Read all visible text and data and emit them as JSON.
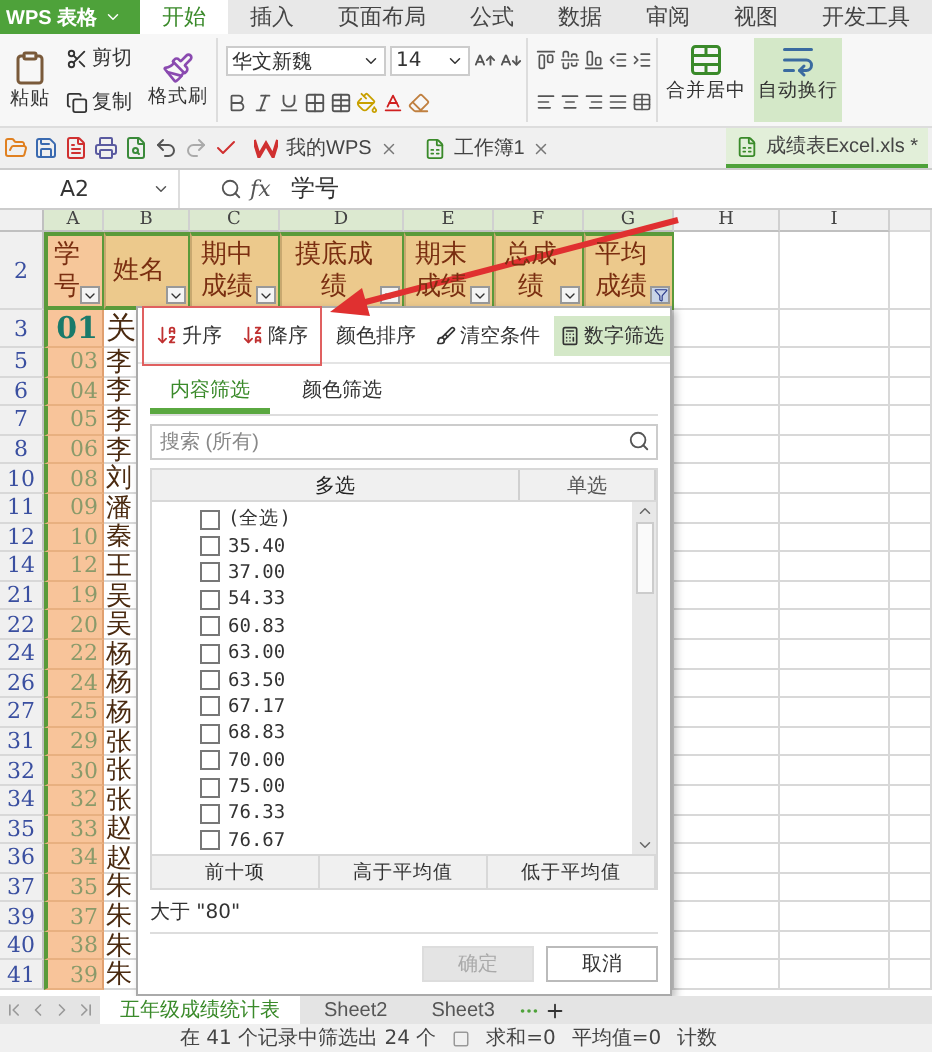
{
  "app_button": {
    "label": "WPS 表格"
  },
  "menu_tabs": [
    {
      "label": "开始",
      "selected": true
    },
    {
      "label": "插入",
      "selected": false
    },
    {
      "label": "页面布局",
      "selected": false
    },
    {
      "label": "公式",
      "selected": false
    },
    {
      "label": "数据",
      "selected": false
    },
    {
      "label": "审阅",
      "selected": false
    },
    {
      "label": "视图",
      "selected": false
    },
    {
      "label": "开发工具",
      "selected": false
    }
  ],
  "ribbon": {
    "paste": "粘贴",
    "cut": "剪切",
    "copy": "复制",
    "format_painter": "格式刷",
    "font_name": "华文新魏",
    "font_size": "14",
    "merge_center": "合并居中",
    "wrap_text": {
      "label": "自动换行",
      "on": true
    }
  },
  "doc_tabs": [
    {
      "label": "我的WPS",
      "kind": "home",
      "selected": false
    },
    {
      "label": "工作簿1",
      "kind": "sheet",
      "selected": false
    },
    {
      "label": "成绩表Excel.xls *",
      "kind": "sheet",
      "selected": true
    }
  ],
  "formula_bar": {
    "cell_ref": "A2",
    "fx": "fx",
    "value": "学号"
  },
  "sheet": {
    "columns": [
      "A",
      "B",
      "C",
      "D",
      "E",
      "F",
      "G",
      "H",
      "I"
    ],
    "header_row": {
      "number": "2",
      "cells": [
        {
          "text": "学号",
          "filtered": false
        },
        {
          "text": "姓名",
          "filtered": false
        },
        {
          "text": "期中成绩",
          "filtered": false
        },
        {
          "text": "摸底成绩",
          "filtered": false
        },
        {
          "text": "期末成绩",
          "filtered": false
        },
        {
          "text": "总成绩",
          "filtered": false
        },
        {
          "text": "平均成绩",
          "filtered": true
        }
      ]
    },
    "rows": [
      {
        "number": "3",
        "id": "01",
        "name": "关"
      },
      {
        "number": "5",
        "id": "03",
        "name": "李"
      },
      {
        "number": "6",
        "id": "04",
        "name": "李"
      },
      {
        "number": "7",
        "id": "05",
        "name": "李"
      },
      {
        "number": "8",
        "id": "06",
        "name": "李"
      },
      {
        "number": "10",
        "id": "08",
        "name": "刘"
      },
      {
        "number": "11",
        "id": "09",
        "name": "潘"
      },
      {
        "number": "12",
        "id": "10",
        "name": "秦"
      },
      {
        "number": "14",
        "id": "12",
        "name": "王"
      },
      {
        "number": "21",
        "id": "19",
        "name": "吴"
      },
      {
        "number": "22",
        "id": "20",
        "name": "吴"
      },
      {
        "number": "24",
        "id": "22",
        "name": "杨"
      },
      {
        "number": "26",
        "id": "24",
        "name": "杨"
      },
      {
        "number": "27",
        "id": "25",
        "name": "杨"
      },
      {
        "number": "31",
        "id": "29",
        "name": "张"
      },
      {
        "number": "32",
        "id": "30",
        "name": "张"
      },
      {
        "number": "34",
        "id": "32",
        "name": "张"
      },
      {
        "number": "35",
        "id": "33",
        "name": "赵"
      },
      {
        "number": "36",
        "id": "34",
        "name": "赵"
      },
      {
        "number": "37",
        "id": "35",
        "name": "朱"
      },
      {
        "number": "39",
        "id": "37",
        "name": "朱"
      },
      {
        "number": "40",
        "id": "38",
        "name": "朱"
      },
      {
        "number": "41",
        "id": "39",
        "name": "朱"
      }
    ]
  },
  "filter_popup": {
    "sort": [
      {
        "label": "升序",
        "kind": "asc"
      },
      {
        "label": "降序",
        "kind": "desc"
      }
    ],
    "color_sort": "颜色排序",
    "clear": "清空条件",
    "number_filter": {
      "label": "数字筛选",
      "on": true
    },
    "tabs": [
      {
        "label": "内容筛选",
        "selected": true
      },
      {
        "label": "颜色筛选",
        "selected": false
      }
    ],
    "search": {
      "placeholder": "搜索 (所有)"
    },
    "list_columns": [
      {
        "label": "多选",
        "selected": true
      },
      {
        "label": "单选",
        "selected": false
      }
    ],
    "items": [
      {
        "label": "(全选)",
        "checked": false
      },
      {
        "label": "35.40",
        "checked": false
      },
      {
        "label": "37.00",
        "checked": false
      },
      {
        "label": "54.33",
        "checked": false
      },
      {
        "label": "60.83",
        "checked": false
      },
      {
        "label": "63.00",
        "checked": false
      },
      {
        "label": "63.50",
        "checked": false
      },
      {
        "label": "67.17",
        "checked": false
      },
      {
        "label": "68.83",
        "checked": false
      },
      {
        "label": "70.00",
        "checked": false
      },
      {
        "label": "75.00",
        "checked": false
      },
      {
        "label": "76.33",
        "checked": false
      },
      {
        "label": "76.67",
        "checked": false
      }
    ],
    "quick_buttons": [
      "前十项",
      "高于平均值",
      "低于平均值"
    ],
    "condition": "大于 \"80\"",
    "ok": {
      "label": "确定",
      "disabled": true
    },
    "cancel": {
      "label": "取消",
      "disabled": false
    }
  },
  "sheet_tabs": [
    {
      "label": "五年级成绩统计表",
      "selected": true
    },
    {
      "label": "Sheet2",
      "selected": false
    },
    {
      "label": "Sheet3",
      "selected": false
    }
  ],
  "status_bar": {
    "filter_summary": "在 41 个记录中筛选出 24 个",
    "sum": "求和=0",
    "average": "平均值=0",
    "count": "计数"
  }
}
